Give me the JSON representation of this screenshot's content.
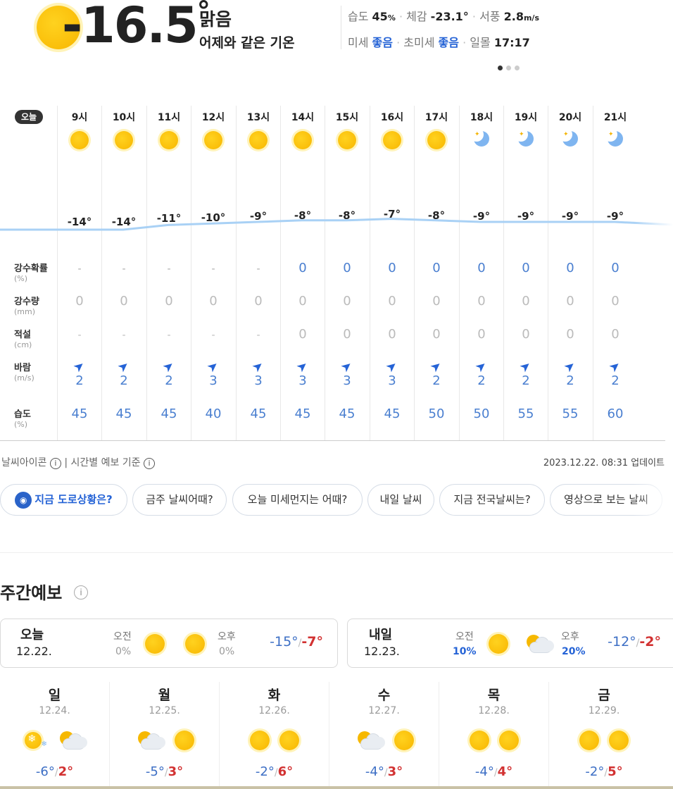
{
  "current": {
    "temp": "-16.5",
    "degree": "°",
    "condition": "맑음",
    "compare": "어제와 같은 기온",
    "humidity_label": "습도",
    "humidity_value": "45",
    "humidity_unit": "%",
    "feels_label": "체감",
    "feels_value": "-23.1°",
    "wind_label": "서풍",
    "wind_value": "2.8",
    "wind_unit": "m/s",
    "pm10_label": "미세",
    "pm10_value": "좋음",
    "pm25_label": "초미세",
    "pm25_value": "좋음",
    "sunset_label": "일몰",
    "sunset_value": "17:17",
    "sep": "·"
  },
  "hourly": {
    "today_badge": "오늘",
    "row_labels": {
      "precip_prob": "강수확률",
      "precip_prob_unit": "(%)",
      "precip": "강수량",
      "precip_unit": "(mm)",
      "snow": "적설",
      "snow_unit": "(cm)",
      "wind": "바람",
      "wind_unit": "(m/s)",
      "humidity": "습도",
      "humidity_unit": "(%)"
    },
    "hours": [
      {
        "hour": "9시",
        "icon": "sun",
        "temp": "-14°",
        "temp_value": -14,
        "prob": "-",
        "precip": "0",
        "snow": "-",
        "wind": "2",
        "hum": "45"
      },
      {
        "hour": "10시",
        "icon": "sun",
        "temp": "-14°",
        "temp_value": -14,
        "prob": "-",
        "precip": "0",
        "snow": "-",
        "wind": "2",
        "hum": "45"
      },
      {
        "hour": "11시",
        "icon": "sun",
        "temp": "-11°",
        "temp_value": -11,
        "prob": "-",
        "precip": "0",
        "snow": "-",
        "wind": "2",
        "hum": "45"
      },
      {
        "hour": "12시",
        "icon": "sun",
        "temp": "-10°",
        "temp_value": -10,
        "prob": "-",
        "precip": "0",
        "snow": "-",
        "wind": "3",
        "hum": "40"
      },
      {
        "hour": "13시",
        "icon": "sun",
        "temp": "-9°",
        "temp_value": -9,
        "prob": "-",
        "precip": "0",
        "snow": "-",
        "wind": "3",
        "hum": "45"
      },
      {
        "hour": "14시",
        "icon": "sun",
        "temp": "-8°",
        "temp_value": -8,
        "prob": "0",
        "precip": "0",
        "snow": "0",
        "wind": "3",
        "hum": "45"
      },
      {
        "hour": "15시",
        "icon": "sun",
        "temp": "-8°",
        "temp_value": -8,
        "prob": "0",
        "precip": "0",
        "snow": "0",
        "wind": "3",
        "hum": "45"
      },
      {
        "hour": "16시",
        "icon": "sun",
        "temp": "-7°",
        "temp_value": -7,
        "prob": "0",
        "precip": "0",
        "snow": "0",
        "wind": "3",
        "hum": "45"
      },
      {
        "hour": "17시",
        "icon": "sun",
        "temp": "-8°",
        "temp_value": -8,
        "prob": "0",
        "precip": "0",
        "snow": "0",
        "wind": "2",
        "hum": "50"
      },
      {
        "hour": "18시",
        "icon": "moon",
        "temp": "-9°",
        "temp_value": -9,
        "prob": "0",
        "precip": "0",
        "snow": "0",
        "wind": "2",
        "hum": "50"
      },
      {
        "hour": "19시",
        "icon": "moon",
        "temp": "-9°",
        "temp_value": -9,
        "prob": "0",
        "precip": "0",
        "snow": "0",
        "wind": "2",
        "hum": "55"
      },
      {
        "hour": "20시",
        "icon": "moon",
        "temp": "-9°",
        "temp_value": -9,
        "prob": "0",
        "precip": "0",
        "snow": "0",
        "wind": "2",
        "hum": "55"
      },
      {
        "hour": "21시",
        "icon": "moon",
        "temp": "-9°",
        "temp_value": -9,
        "prob": "0",
        "precip": "0",
        "snow": "0",
        "wind": "2",
        "hum": "60"
      }
    ],
    "footer_icon_text": "날씨아이콘",
    "footer_basis_text": "| 시간별 예보 기준",
    "update_text": "2023.12.22. 08:31 업데이트"
  },
  "chips": [
    "지금 도로상황은?",
    "금주 날씨어때?",
    "오늘 미세먼지는 어때?",
    "내일 날씨",
    "지금 전국날씨는?",
    "영상으로 보는 날씨"
  ],
  "weekly": {
    "title": "주간예보",
    "today": {
      "day": "오늘",
      "date": "12.22.",
      "am_label": "오전",
      "am_prob": "0%",
      "pm_label": "오후",
      "pm_prob": "0%",
      "low": "-15°",
      "high": "-7°"
    },
    "tomorrow": {
      "day": "내일",
      "date": "12.23.",
      "am_label": "오전",
      "am_prob": "10%",
      "pm_label": "오후",
      "pm_prob": "20%",
      "low": "-12°",
      "high": "-2°"
    },
    "days": [
      {
        "day": "일",
        "date": "12.24.",
        "low": "-6°",
        "high": "2°"
      },
      {
        "day": "월",
        "date": "12.25.",
        "low": "-5°",
        "high": "3°"
      },
      {
        "day": "화",
        "date": "12.26.",
        "low": "-2°",
        "high": "6°"
      },
      {
        "day": "수",
        "date": "12.27.",
        "low": "-4°",
        "high": "3°"
      },
      {
        "day": "목",
        "date": "12.28.",
        "low": "-4°",
        "high": "4°"
      },
      {
        "day": "금",
        "date": "12.29.",
        "low": "-2°",
        "high": "5°"
      }
    ]
  },
  "colors": {
    "accent_blue": "#2563d6",
    "temp_low": "#3d6fc5",
    "temp_high": "#d23232",
    "line": "#a9d1f5"
  }
}
